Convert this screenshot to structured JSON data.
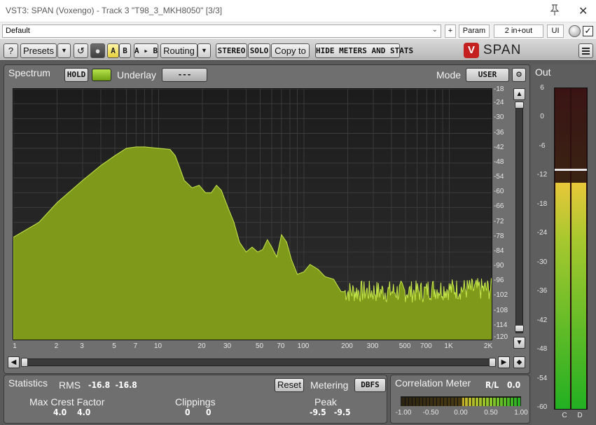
{
  "window": {
    "title": "VST3: SPAN (Voxengo) - Track 3 \"T98_3_MKH8050\" [3/3]",
    "close_glyph": "✕"
  },
  "host": {
    "preset": "Default",
    "plus": "+",
    "param": "Param",
    "io": "2 in+out",
    "ui": "UI",
    "checkbox_checked": true
  },
  "toolbar": {
    "help": "?",
    "presets": "Presets",
    "a": "A",
    "b": "B",
    "ab": "A ▸ B",
    "routing": "Routing",
    "stereo": "STEREO",
    "solo": "SOLO",
    "copy_to": "Copy to",
    "hide_meters": "HIDE METERS AND STATS",
    "logo": "SPAN"
  },
  "spectrum": {
    "label": "Spectrum",
    "hold": "HOLD",
    "underlay_label": "Underlay",
    "underlay_value": "---",
    "mode_label": "Mode",
    "mode_value": "USER",
    "y_ticks": [
      "-18",
      "-24",
      "-30",
      "-36",
      "-42",
      "-48",
      "-54",
      "-60",
      "-66",
      "-72",
      "-78",
      "-84",
      "-90",
      "-96",
      "-102",
      "-108",
      "-114",
      "-120"
    ],
    "x_ticks": [
      "1",
      "2",
      "3",
      "5",
      "7",
      "10",
      "20",
      "30",
      "50",
      "70",
      "100",
      "200",
      "300",
      "500",
      "700",
      "1K",
      "2K"
    ],
    "fill_color": "#7f9a1b",
    "line_color": "#c6e84a"
  },
  "out": {
    "label": "Out",
    "ticks": [
      "6",
      "0",
      "-6",
      "-12",
      "-18",
      "-24",
      "-30",
      "-36",
      "-42",
      "-48",
      "-54",
      "-60"
    ],
    "channels": [
      "C",
      "D"
    ]
  },
  "statistics": {
    "label": "Statistics",
    "rms_label": "RMS",
    "rms_values": "-16.8  -16.8",
    "reset": "Reset",
    "metering_label": "Metering",
    "metering_value": "DBFS",
    "crest_label": "Max Crest Factor",
    "crest_values": "4.0    4.0",
    "clip_label": "Clippings",
    "clip_values": "0      0",
    "peak_label": "Peak",
    "peak_values": "-9.5   -9.5"
  },
  "correlation": {
    "label": "Correlation Meter",
    "rl_label": "R/L",
    "rl_value": "0.0",
    "ticks": [
      "-1.00",
      "-0.50",
      "0.00",
      "0.50",
      "1.00"
    ]
  }
}
